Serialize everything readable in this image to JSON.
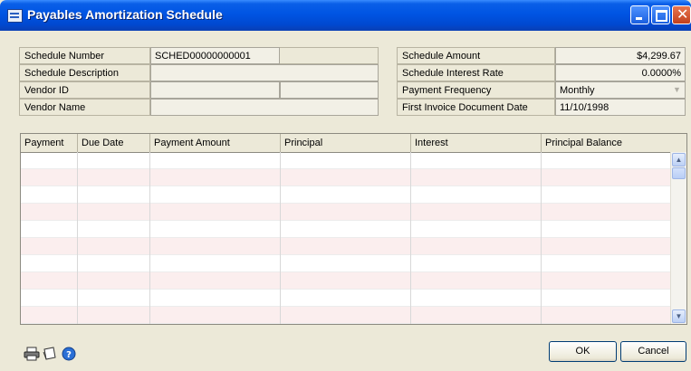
{
  "window": {
    "title": "Payables Amortization Schedule"
  },
  "fields": {
    "schedule_number_label": "Schedule Number",
    "schedule_number_value": "SCHED00000000001",
    "schedule_description_label": "Schedule Description",
    "schedule_description_value": "",
    "vendor_id_label": "Vendor ID",
    "vendor_id_value": "",
    "vendor_name_label": "Vendor Name",
    "vendor_name_value": "",
    "schedule_amount_label": "Schedule Amount",
    "schedule_amount_value": "$4,299.67",
    "interest_rate_label": "Schedule Interest Rate",
    "interest_rate_value": "0.0000%",
    "payment_frequency_label": "Payment Frequency",
    "payment_frequency_value": "Monthly",
    "first_invoice_date_label": "First Invoice Document Date",
    "first_invoice_date_value": "11/10/1998"
  },
  "grid": {
    "columns": [
      "Payment",
      "Due Date",
      "Payment Amount",
      "Principal",
      "Interest",
      "Principal Balance"
    ],
    "rows": []
  },
  "buttons": {
    "ok": "OK",
    "cancel": "Cancel"
  },
  "icons": [
    "printer-icon",
    "note-icon",
    "help-icon"
  ]
}
